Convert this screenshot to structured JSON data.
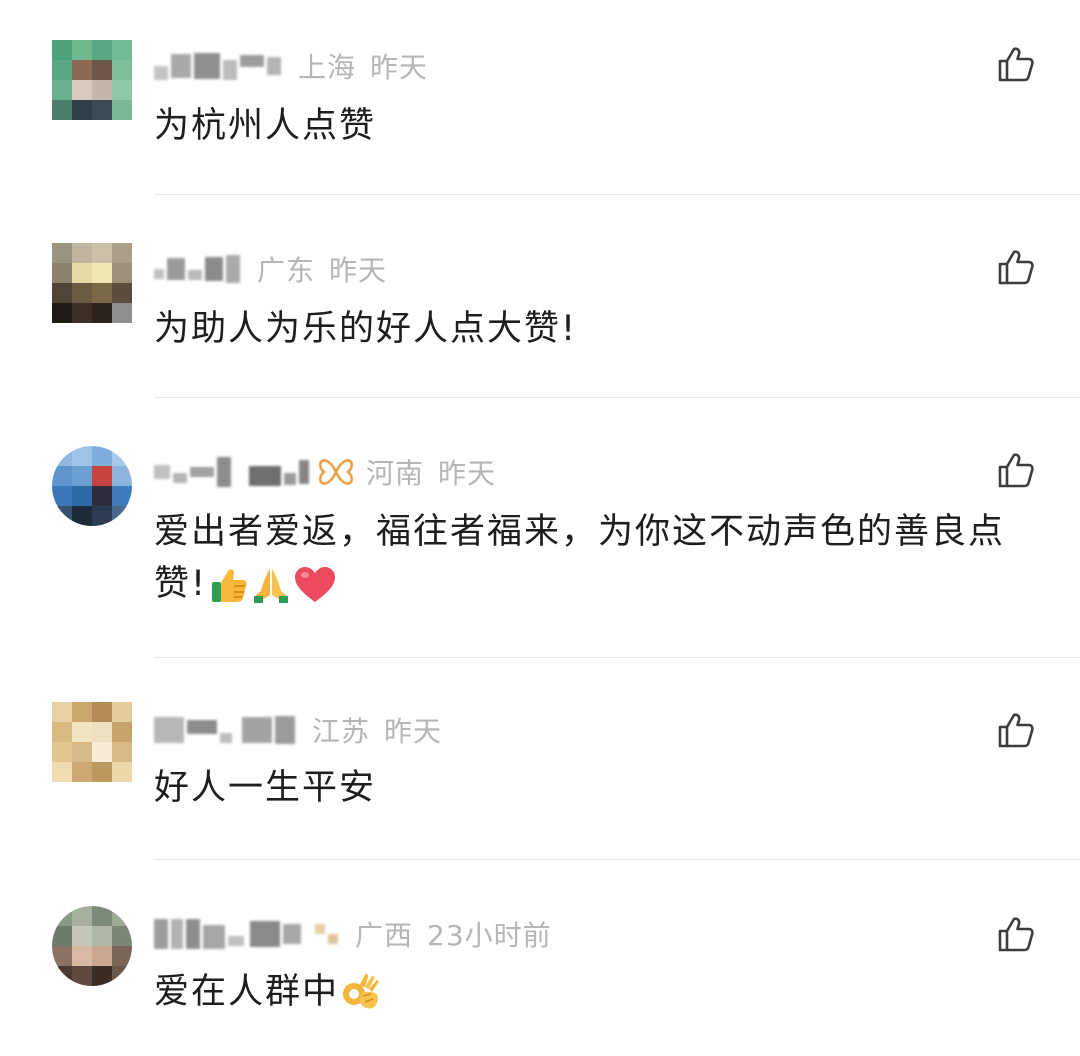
{
  "comments": [
    {
      "name": "",
      "location": "上海",
      "time": "昨天",
      "text": "为杭州人点赞"
    },
    {
      "name": "",
      "location": "广东",
      "time": "昨天",
      "text": "为助人为乐的好人点大赞!"
    },
    {
      "name": "",
      "location": "河南",
      "time": "昨天",
      "text": "爱出者爱返，福往者福来，为你这不动声色的善良点赞!"
    },
    {
      "name": "",
      "location": "江苏",
      "time": "昨天",
      "text": "好人一生平安"
    },
    {
      "name": "",
      "location": "广西",
      "time": "23小时前",
      "text": "爱在人群中"
    }
  ],
  "icons": {
    "like": "thumbs-up-outline-icon",
    "badge": "butterfly-badge-icon",
    "emoji_thumbs": "thumbs-up-emoji",
    "emoji_pray": "folded-hands-emoji",
    "emoji_heart": "red-heart-emoji",
    "emoji_ok": "ok-hand-emoji"
  },
  "colors": {
    "meta_text": "#b6b6b6",
    "body_text": "#1e1e1e",
    "divider": "#e8e8e8",
    "badge": "#e8a24a"
  }
}
